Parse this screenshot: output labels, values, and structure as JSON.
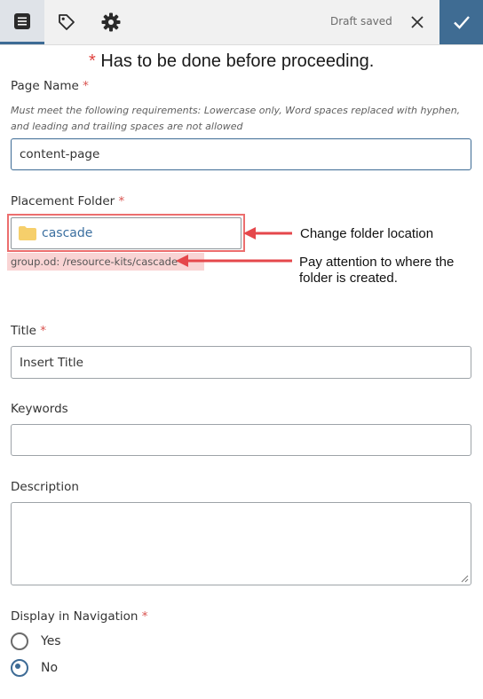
{
  "toolbar": {
    "status": "Draft saved",
    "tabs": [
      {
        "icon": "content-icon",
        "active": true
      },
      {
        "icon": "tag-icon",
        "active": false
      },
      {
        "icon": "gear-icon",
        "active": false
      }
    ],
    "accent_color": "#3f6c93"
  },
  "banner": {
    "star": "*",
    "text": "Has to be done before proceeding."
  },
  "page_name": {
    "label": "Page Name",
    "required_mark": "*",
    "hint": "Must meet the following requirements: Lowercase only, Word spaces replaced with hyphen, and leading and trailing spaces are not allowed",
    "value": "content-page"
  },
  "placement_folder": {
    "label": "Placement Folder",
    "required_mark": "*",
    "folder": "cascade",
    "path": "group.od: /resource-kits/cascade"
  },
  "callouts": {
    "folder": "Change folder location",
    "path_line1": "Pay attention to where the",
    "path_line2": "folder is created."
  },
  "title": {
    "label": "Title",
    "required_mark": "*",
    "placeholder": "Insert Title"
  },
  "keywords": {
    "label": "Keywords",
    "value": ""
  },
  "description": {
    "label": "Description",
    "value": ""
  },
  "display_in_navigation": {
    "label": "Display in Navigation",
    "required_mark": "*",
    "options": [
      "Yes",
      "No"
    ],
    "selected": "No"
  }
}
